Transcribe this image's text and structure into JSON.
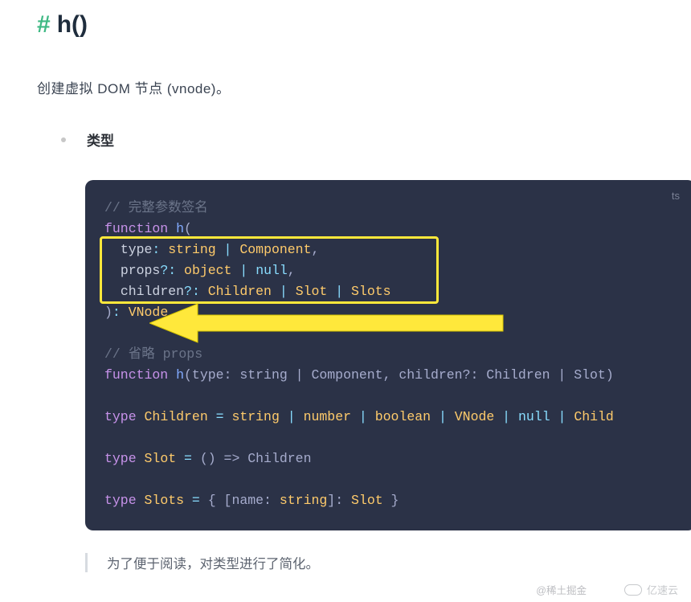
{
  "heading": {
    "hash": "#",
    "title": "h()"
  },
  "intro": "创建虚拟 DOM 节点 (vnode)。",
  "section_label": "类型",
  "code": {
    "lang": "ts",
    "c1": "// 完整参数签名",
    "kw_function": "function",
    "fn_name": "h",
    "paren_open": "(",
    "param1_name": "type",
    "param1_types_a": "string",
    "param1_types_b": "Component",
    "param2_name": "props",
    "opt": "?",
    "param2_types_a": "object",
    "param2_types_b": "null",
    "param3_name": "children",
    "param3_types_a": "Children",
    "param3_types_b": "Slot",
    "param3_types_c": "Slots",
    "paren_close": ")",
    "ret_type": "VNode",
    "c2": "// 省略 props",
    "sig2_tail": "(type: string | Component, children?: Children | Slot)",
    "kw_type": "type",
    "td_children_lhs": "Children",
    "td_children_rhs_parts": [
      "string",
      "number",
      "boolean",
      "VNode",
      "null",
      "Child"
    ],
    "td_slot_lhs": "Slot",
    "td_slot_rhs": "() => Children",
    "td_slots_lhs": "Slots",
    "td_slots_rhs_open": "{ [name: ",
    "td_slots_rhs_key_t": "string",
    "td_slots_rhs_mid": "]: ",
    "td_slots_rhs_val": "Slot",
    "td_slots_rhs_close": " }",
    "colon": ":",
    "comma": ",",
    "pipe": " | ",
    "eq": " = "
  },
  "quote": "为了便于阅读，对类型进行了简化。",
  "watermarks": {
    "left": "@稀土掘金",
    "right": "亿速云"
  }
}
